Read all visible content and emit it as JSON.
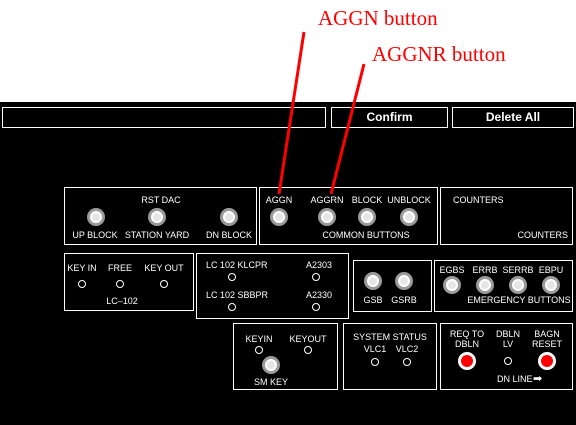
{
  "annotations": {
    "aggn": "AGGN button",
    "aggnr": "AGGNR button"
  },
  "topbar": {
    "confirm": "Confirm",
    "delete_all": "Delete All"
  },
  "rst_dac": {
    "title": "RST DAC",
    "buttons": [
      "UP BLOCK",
      "STATION YARD",
      "DN BLOCK"
    ]
  },
  "common": {
    "buttons": [
      "AGGN",
      "AGGRN",
      "BLOCK",
      "UNBLOCK"
    ],
    "caption": "COMMON BUTTONS"
  },
  "counters": {
    "title": "COUNTERS",
    "caption": "COUNTERS"
  },
  "lc102": {
    "lamps": [
      "KEY IN",
      "FREE",
      "KEY OUT"
    ],
    "caption": "LC–102"
  },
  "klcpr": {
    "row1_label": "LC 102 KLCPR",
    "row1_code": "A2303",
    "row2_label": "LC 102 SBBPR",
    "row2_code": "A2330"
  },
  "gsb": {
    "buttons": [
      "GSB",
      "GSRB"
    ]
  },
  "emergency": {
    "buttons": [
      "EGBS",
      "ERRB",
      "SERRB",
      "EBPU"
    ],
    "caption": "EMERGENCY BUTTONS"
  },
  "smkey": {
    "lamps": [
      "KEYIN",
      "KEYOUT"
    ],
    "caption": "SM KEY"
  },
  "system_status": {
    "title": "SYSTEM STATUS",
    "lamps": [
      "VLC1",
      "VLC2"
    ]
  },
  "dn_line": {
    "req_line1": "REQ TO",
    "req_line2": "DBLN",
    "dbln_line1": "DBLN",
    "dbln_line2": "LV",
    "bagn_line1": "BAGN",
    "bagn_line2": "RESET",
    "caption": "DN LINE",
    "arrow": "➡"
  },
  "icons": {
    "button": "push-button-icon",
    "lamp": "indicator-lamp-icon",
    "arrow": "right-arrow-icon"
  },
  "colors": {
    "annotation": "#ff0000",
    "panel": "#000000",
    "active_button": "#ff0000"
  }
}
